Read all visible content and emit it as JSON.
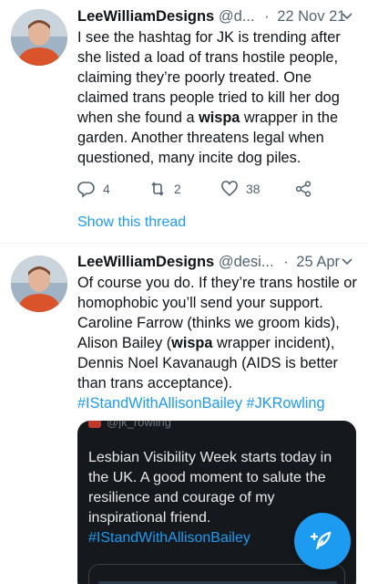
{
  "tweets": [
    {
      "name": "LeeWilliamDesigns",
      "handle": "@d...",
      "date": "22 Nov 21",
      "body": [
        {
          "text": "I see the hashtag for JK is trending after she listed a load of trans hostile people, claiming they’re poorly treated. One claimed trans people tried to kill her dog when she found a "
        },
        {
          "text": "wispa",
          "bold": true
        },
        {
          "text": " wrapper in the garden. Another threatens legal when questioned, many incite dog piles."
        }
      ],
      "reply_count": "4",
      "retweet_count": "2",
      "like_count": "38",
      "show_thread_label": "Show this thread"
    },
    {
      "name": "LeeWilliamDesigns",
      "handle": "@desi...",
      "date": "25 Apr",
      "body": [
        {
          "text": "Of course you do. If they’re trans hostile or homophobic you’ll send your support. Caroline Farrow (thinks we groom kids), Alison Bailey ("
        },
        {
          "text": "wispa",
          "bold": true
        },
        {
          "text": " wrapper incident), Dennis Noel Kavanaugh (AIDS is better than trans acceptance). "
        },
        {
          "text": "#IStandWithAllisonBailey",
          "tag": true
        },
        {
          "text": " "
        },
        {
          "text": "#JKRowling",
          "tag": true
        }
      ],
      "quote": {
        "handle": "@jk_rowling",
        "text": "Lesbian Visibility Week starts today in the UK. A good moment to salute the resilience and courage of my inspirational friend.",
        "hashtag": "#IStandWithAllisonBailey"
      }
    }
  ],
  "icons": {
    "reply": "reply-icon",
    "retweet": "retweet-icon",
    "like": "heart-icon",
    "share": "share-icon",
    "caret": "chevron-down-icon",
    "compose": "compose-feather-icon"
  },
  "colors": {
    "accent": "#1d9bf0",
    "text": "#0f1419",
    "muted": "#536471"
  }
}
